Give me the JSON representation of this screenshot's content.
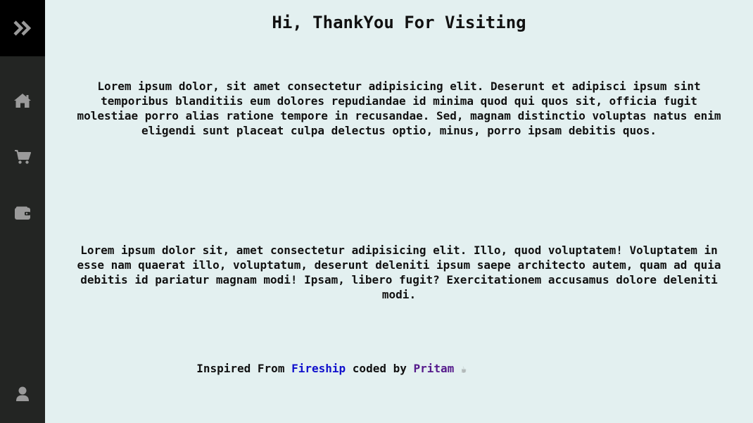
{
  "sidebar": {
    "toggle_icon": "double-chevron-right-icon",
    "items": [
      {
        "name": "home",
        "icon": "home-icon"
      },
      {
        "name": "cart",
        "icon": "cart-icon"
      },
      {
        "name": "wallet",
        "icon": "wallet-icon"
      }
    ],
    "profile_icon": "user-icon",
    "colors": {
      "top": "#000000",
      "body": "#232523",
      "icon": "#9a9a9a"
    }
  },
  "main": {
    "title": "Hi, ThankYou For Visiting",
    "paragraph_1": "Lorem ipsum dolor, sit amet consectetur adipisicing elit. Deserunt et adipisci ipsum sint temporibus blanditiis eum dolores repudiandae id minima quod qui quos sit, officia fugit molestiae porro alias ratione tempore in recusandae. Sed, magnam distinctio voluptas natus enim eligendi sunt placeat culpa delectus optio, minus, porro ipsam debitis quos.",
    "paragraph_2": "Lorem ipsum dolor sit, amet consectetur adipisicing elit. Illo, quod voluptatem! Voluptatem in esse nam quaerat illo, voluptatum, deserunt deleniti ipsum saepe architecto autem, quam ad quia debitis id pariatur magnam modi! Ipsam, libero fugit? Exercitationem accusamus dolore deleniti modi.",
    "background": "#e3f0f0"
  },
  "footer": {
    "prefix": "Inspired From",
    "link_1": "Fireship",
    "middle": "coded by",
    "link_2": "Pritam",
    "emoji": "☕"
  }
}
